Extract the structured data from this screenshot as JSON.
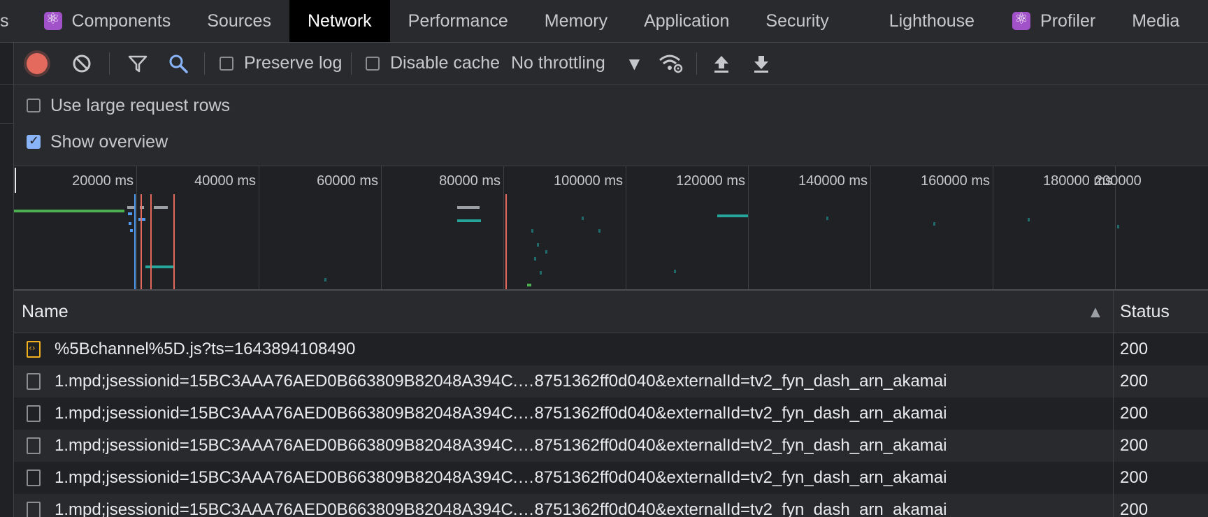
{
  "tabs": [
    {
      "label": "s"
    },
    {
      "label": "Components"
    },
    {
      "label": "Sources"
    },
    {
      "label": "Network"
    },
    {
      "label": "Performance"
    },
    {
      "label": "Memory"
    },
    {
      "label": "Application"
    },
    {
      "label": "Security"
    },
    {
      "label": "Lighthouse"
    },
    {
      "label": "Profiler"
    },
    {
      "label": "Media"
    }
  ],
  "active_tab": "Network",
  "toolbar": {
    "preserve_log": "Preserve log",
    "preserve_log_checked": false,
    "disable_cache": "Disable cache",
    "disable_cache_checked": false,
    "throttling": "No throttling"
  },
  "options": {
    "large_rows": "Use large request rows",
    "large_rows_checked": false,
    "show_overview": "Show overview",
    "show_overview_checked": true
  },
  "overview": {
    "ticks": [
      "20000 ms",
      "40000 ms",
      "60000 ms",
      "80000 ms",
      "100000 ms",
      "120000 ms",
      "140000 ms",
      "160000 ms",
      "180000 ms",
      "200000"
    ]
  },
  "table": {
    "columns": {
      "name": "Name",
      "status": "Status"
    },
    "rows": [
      {
        "name": "%5Bchannel%5D.js?ts=1643894108490",
        "status": "200",
        "type": "script"
      },
      {
        "name": "1.mpd;jsessionid=15BC3AAA76AED0B663809B82048A394C.…8751362ff0d040&externalId=tv2_fyn_dash_arn_akamai",
        "status": "200",
        "type": "document"
      },
      {
        "name": "1.mpd;jsessionid=15BC3AAA76AED0B663809B82048A394C.…8751362ff0d040&externalId=tv2_fyn_dash_arn_akamai",
        "status": "200",
        "type": "document"
      },
      {
        "name": "1.mpd;jsessionid=15BC3AAA76AED0B663809B82048A394C.…8751362ff0d040&externalId=tv2_fyn_dash_arn_akamai",
        "status": "200",
        "type": "document"
      },
      {
        "name": "1.mpd;jsessionid=15BC3AAA76AED0B663809B82048A394C.…8751362ff0d040&externalId=tv2_fyn_dash_arn_akamai",
        "status": "200",
        "type": "document"
      },
      {
        "name": "1.mpd;jsessionid=15BC3AAA76AED0B663809B82048A394C.…8751362ff0d040&externalId=tv2_fyn_dash_arn_akamai",
        "status": "200",
        "type": "document"
      }
    ]
  },
  "colors": {
    "record": "#e46a5e",
    "accent": "#8ab4f8",
    "waterfall_green": "#4caf50",
    "waterfall_teal": "#26a69a",
    "waterfall_blue": "#4e9bf0",
    "waterfall_red": "#e46a5e"
  },
  "icons": [
    "record-icon",
    "clear-icon",
    "filter-icon",
    "search-icon",
    "network-conditions-icon",
    "import-icon",
    "export-icon",
    "react-icon",
    "sort-ascending-icon",
    "script-file-icon",
    "document-file-icon"
  ]
}
